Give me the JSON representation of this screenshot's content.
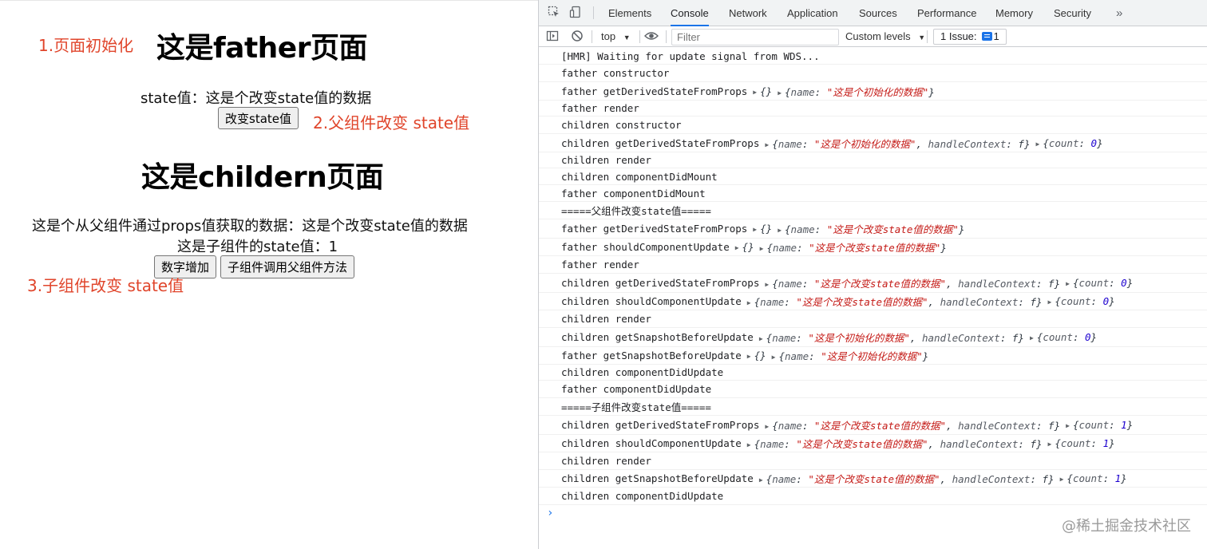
{
  "left": {
    "annot_init": "1.页面初始化",
    "father_title": "这是father页面",
    "state_text": "state值：这是个改变state值的数据",
    "change_state_btn": "改变state值",
    "annot_parent": "2.父组件改变 state值",
    "children_title": "这是childern页面",
    "props_text": "这是个从父组件通过props值获取的数据：这是个改变state值的数据",
    "child_state_text": "这是子组件的state值：1",
    "add_btn": "数字增加",
    "call_parent_btn": "子组件调用父组件方法",
    "annot_child": "3.子组件改变 state值"
  },
  "devtools": {
    "tabs": [
      "Elements",
      "Console",
      "Network",
      "Application",
      "Sources",
      "Performance",
      "Memory",
      "Security"
    ],
    "active_tab": "Console",
    "more": "»",
    "toolbar": {
      "context": "top",
      "filter_placeholder": "Filter",
      "levels": "Custom levels",
      "issue_label": "1 Issue:",
      "issue_count": "1"
    },
    "icons": {
      "inspect": "inspect-icon",
      "device": "device-toggle-icon",
      "sidebar": "sidebar-toggle-icon",
      "clear": "clear-console-icon",
      "eye": "live-expression-icon"
    },
    "accent": "#1a73e8",
    "string_color": "#c41a16",
    "number_color": "#1c00cf"
  },
  "console": {
    "lines": [
      {
        "t": "[HMR] Waiting for update signal from WDS..."
      },
      {
        "t": "father constructor"
      },
      {
        "t": "father getDerivedStateFromProps",
        "parts": [
          {
            "t": "{}"
          },
          {
            "t": "{name: \"这是个初始化的数据\"}"
          }
        ]
      },
      {
        "t": "father render"
      },
      {
        "t": "children constructor"
      },
      {
        "t": "children getDerivedStateFromProps",
        "parts": [
          {
            "t": "{name: \"这是个初始化的数据\", handleContext: f}"
          },
          {
            "t": "{count: 0}"
          }
        ]
      },
      {
        "t": "children render"
      },
      {
        "t": "children componentDidMount"
      },
      {
        "t": "father componentDidMount"
      },
      {
        "t": "=====父组件改变state值====="
      },
      {
        "t": "father getDerivedStateFromProps",
        "parts": [
          {
            "t": "{}"
          },
          {
            "t": "{name: \"这是个改变state值的数据\"}"
          }
        ]
      },
      {
        "t": "father shouldComponentUpdate",
        "parts": [
          {
            "t": "{}"
          },
          {
            "t": "{name: \"这是个改变state值的数据\"}"
          }
        ]
      },
      {
        "t": "father render"
      },
      {
        "t": "children getDerivedStateFromProps",
        "parts": [
          {
            "t": "{name: \"这是个改变state值的数据\", handleContext: f}"
          },
          {
            "t": "{count: 0}"
          }
        ]
      },
      {
        "t": "children shouldComponentUpdate",
        "parts": [
          {
            "t": "{name: \"这是个改变state值的数据\", handleContext: f}"
          },
          {
            "t": "{count: 0}"
          }
        ]
      },
      {
        "t": "children render"
      },
      {
        "t": "children getSnapshotBeforeUpdate",
        "parts": [
          {
            "t": "{name: \"这是个初始化的数据\", handleContext: f}"
          },
          {
            "t": "{count: 0}"
          }
        ]
      },
      {
        "t": "father getSnapshotBeforeUpdate",
        "parts": [
          {
            "t": "{}"
          },
          {
            "t": "{name: \"这是个初始化的数据\"}"
          }
        ]
      },
      {
        "t": "children componentDidUpdate"
      },
      {
        "t": "father componentDidUpdate"
      },
      {
        "t": "=====子组件改变state值====="
      },
      {
        "t": "children getDerivedStateFromProps",
        "parts": [
          {
            "t": "{name: \"这是个改变state值的数据\", handleContext: f}"
          },
          {
            "t": "{count: 1}"
          }
        ]
      },
      {
        "t": "children shouldComponentUpdate",
        "parts": [
          {
            "t": "{name: \"这是个改变state值的数据\", handleContext: f}"
          },
          {
            "t": "{count: 1}"
          }
        ]
      },
      {
        "t": "children render"
      },
      {
        "t": "children getSnapshotBeforeUpdate",
        "parts": [
          {
            "t": "{name: \"这是个改变state值的数据\", handleContext: f}"
          },
          {
            "t": "{count: 1}"
          }
        ]
      },
      {
        "t": "children componentDidUpdate"
      }
    ],
    "prompt": "›",
    "watermark": "@稀土掘金技术社区"
  }
}
